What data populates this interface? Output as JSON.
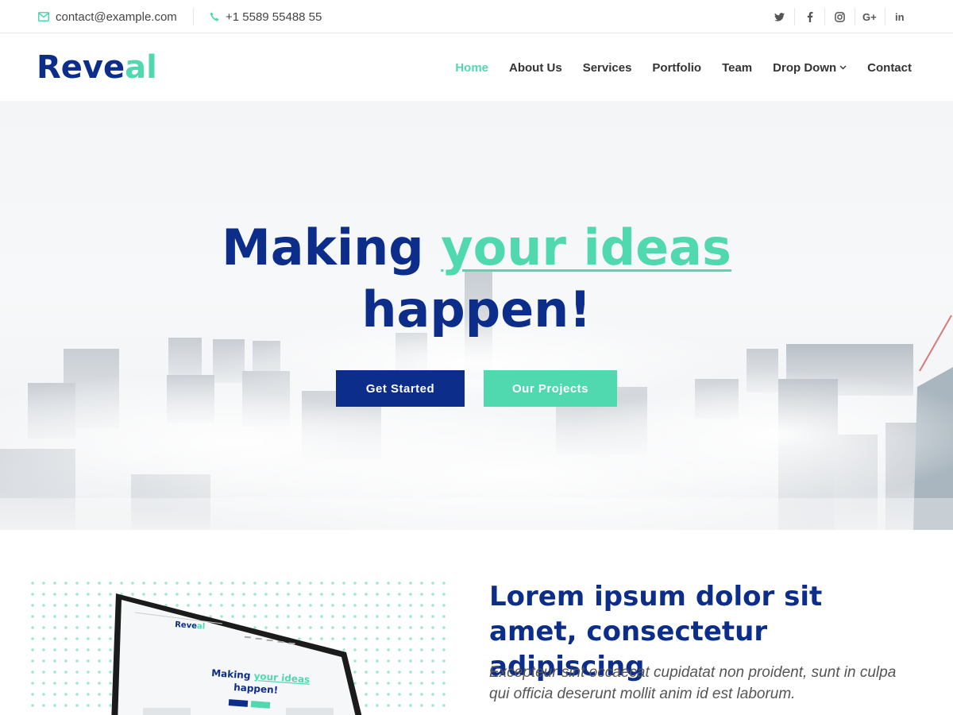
{
  "topbar": {
    "email": "contact@example.com",
    "phone": "+1 5589 55488 55",
    "socials": [
      {
        "icon": "twitter-icon",
        "glyph": "🐦"
      },
      {
        "icon": "facebook-icon",
        "glyph": "f"
      },
      {
        "icon": "instagram-icon",
        "glyph": "◎"
      },
      {
        "icon": "google-plus-icon",
        "glyph": "G+"
      },
      {
        "icon": "linkedin-icon",
        "glyph": "in"
      }
    ]
  },
  "header": {
    "logo_main": "Reve",
    "logo_accent": "al",
    "nav": [
      {
        "label": "Home",
        "active": true
      },
      {
        "label": "About Us"
      },
      {
        "label": "Services"
      },
      {
        "label": "Portfolio"
      },
      {
        "label": "Team"
      },
      {
        "label": "Drop Down",
        "dropdown": true
      },
      {
        "label": "Contact"
      }
    ]
  },
  "hero": {
    "title_part1": "Making ",
    "title_highlight": "your ideas",
    "title_part2": "happen!",
    "btn_primary": "Get Started",
    "btn_secondary": "Our Projects"
  },
  "about": {
    "title": "Lorem ipsum dolor sit amet, consectetur adipiscing",
    "text": "Excepteur sint occaecat cupidatat non proident, sunt in culpa qui officia deserunt mollit anim id est laborum.",
    "laptop_screen": {
      "logo_main": "Reve",
      "logo_accent": "al",
      "title_part1": "Making ",
      "title_highlight": "your ideas",
      "title_part2": "happen!"
    }
  },
  "colors": {
    "primary": "#0c2e8a",
    "accent": "#50d8af"
  }
}
